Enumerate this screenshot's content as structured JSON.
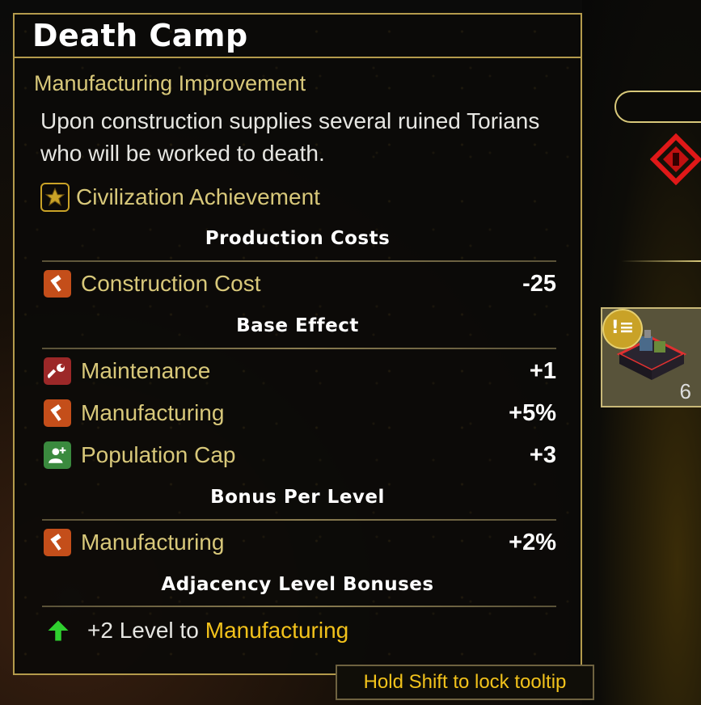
{
  "tooltip": {
    "title": "Death Camp",
    "subtitle": "Manufacturing Improvement",
    "description": "Upon construction supplies several ruined Torians who will be worked to death.",
    "achievement": {
      "label": "Civilization Achievement",
      "icon": "star-icon"
    },
    "sections": {
      "production_costs": "Production Costs",
      "base_effect": "Base Effect",
      "bonus_per_level": "Bonus Per Level",
      "adjacency": "Adjacency Level Bonuses"
    },
    "production_costs": [
      {
        "icon": "hammer-icon",
        "label": "Construction Cost",
        "value": "-25"
      }
    ],
    "base_effect": [
      {
        "icon": "wrench-icon",
        "label": "Maintenance",
        "value": "+1"
      },
      {
        "icon": "hammer-icon",
        "label": "Manufacturing",
        "value": "+5%"
      },
      {
        "icon": "population-add-icon",
        "label": "Population Cap",
        "value": "+3"
      }
    ],
    "bonus_per_level": [
      {
        "icon": "hammer-icon",
        "label": "Manufacturing",
        "value": "+2%"
      }
    ],
    "adjacency_bonus": {
      "icon": "green-up-arrow-icon",
      "text": "+2 Level to",
      "target": "Manufacturing"
    }
  },
  "hint": "Hold Shift to lock tooltip",
  "building_card": {
    "count": "6",
    "badge_icon": "alert-list-icon"
  },
  "colors": {
    "accent_gold": "#d8c87a",
    "highlight_yellow": "#f2c21b",
    "border_gold": "#b49b4c",
    "hammer_orange": "#c44e1a",
    "wrench_red": "#9c2828",
    "population_green": "#3a8a3e"
  }
}
